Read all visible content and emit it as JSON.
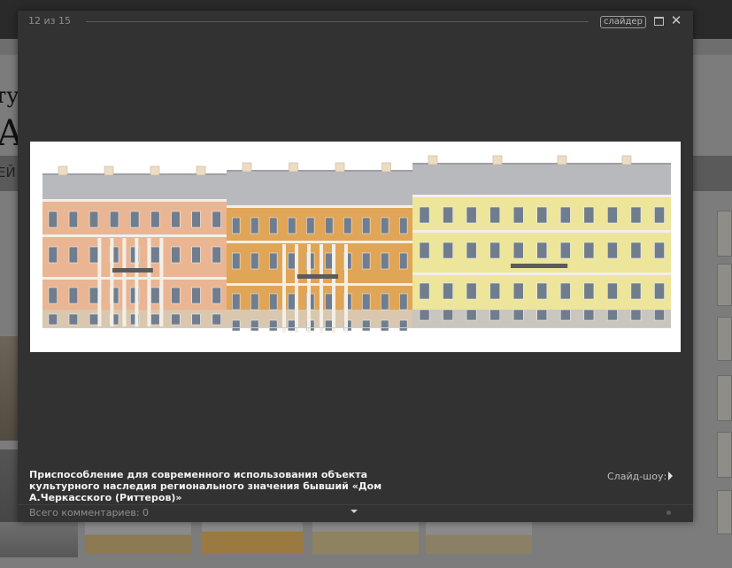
{
  "background_page": {
    "heading_small": "ту",
    "heading_big": "А",
    "band_text": "ЕЙ"
  },
  "lightbox": {
    "counter": "12 из 15",
    "slider_label": "слайдер",
    "caption": "Приспособление для современного использования объекта культурного наследия регионального значения бывший «Дом А.Черкасского (Риттеров)»",
    "slideshow_label": "Слайд-шоу:",
    "comments_label": "Всего комментариев: 0",
    "icons": {
      "fullscreen": "maximize-icon",
      "close": "close-icon",
      "play": "play-icon",
      "comments_toggle": "chevron-down-icon"
    }
  },
  "colors": {
    "modal_bg": "#323232",
    "facade_left": "#eab593",
    "facade_middle": "#e0a556",
    "facade_right": "#ece59a",
    "roof": "#b7b9bc"
  }
}
